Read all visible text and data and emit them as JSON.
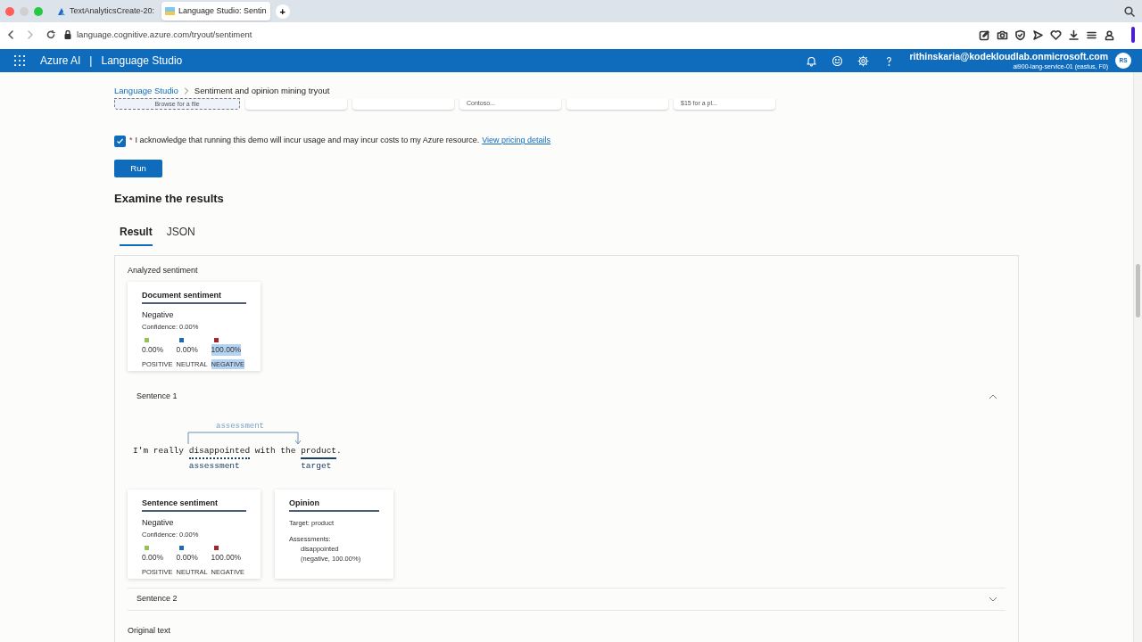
{
  "browser": {
    "tabs": [
      {
        "title": "TextAnalyticsCreate-20:",
        "selected": false
      },
      {
        "title": "Language Studio: Sentin",
        "selected": true
      }
    ],
    "new_tab": "+",
    "url": "language.cognitive.azure.com/tryout/sentiment"
  },
  "header": {
    "brand": "Azure AI",
    "separator": "|",
    "product": "Language Studio",
    "account": "rithinskaria@kodekloudlab.onmicrosoft.com",
    "resource": "ai900-lang-service-01 (eastus, F0)",
    "avatar": "RS"
  },
  "breadcrumb": [
    "Language Studio",
    "Sentiment and opinion mining tryout"
  ],
  "samples": [
    {
      "kind": "browse",
      "text": "Browse for a file"
    },
    {
      "kind": "card"
    },
    {
      "kind": "card"
    },
    {
      "kind": "card",
      "text": "Contoso..."
    },
    {
      "kind": "card"
    },
    {
      "kind": "card",
      "text": "$15 for a pl..."
    }
  ],
  "acknowledge": {
    "checked": true,
    "required": "*",
    "text": "I acknowledge that running this demo will incur usage and may incur costs to my Azure resource.",
    "link": "View pricing details"
  },
  "run_button": "Run",
  "results_heading": "Examine the results",
  "result_tabs": [
    {
      "label": "Result",
      "selected": true
    },
    {
      "label": "JSON",
      "selected": false
    }
  ],
  "analyzed_heading": "Analyzed sentiment",
  "document_sentiment": {
    "title": "Document sentiment",
    "label": "Negative",
    "confidence": "Confidence: 0.00%",
    "scores": [
      {
        "value": "0.00%",
        "name": "POSITIVE",
        "color": "#92c353",
        "selected": false
      },
      {
        "value": "0.00%",
        "name": "NEUTRAL",
        "color": "#1f6bb3",
        "selected": false
      },
      {
        "value": "100.00%",
        "name": "NEGATIVE",
        "color": "#a4262c",
        "selected": true
      }
    ]
  },
  "sentences": [
    {
      "title": "Sentence 1",
      "expanded": true,
      "relation": "assessment",
      "tokens": [
        {
          "text": "I'm really ",
          "kind": "plain"
        },
        {
          "text": "disappointed",
          "kind": "assessment",
          "label": "assessment"
        },
        {
          "text": " with the ",
          "kind": "plain"
        },
        {
          "text": "product",
          "kind": "target",
          "label": "target"
        },
        {
          "text": ".",
          "kind": "plain"
        }
      ],
      "sentence_sentiment": {
        "title": "Sentence sentiment",
        "label": "Negative",
        "confidence": "Confidence: 0.00%",
        "scores": [
          {
            "value": "0.00%",
            "name": "POSITIVE",
            "color": "#92c353",
            "selected": false
          },
          {
            "value": "0.00%",
            "name": "NEUTRAL",
            "color": "#1f6bb3",
            "selected": false
          },
          {
            "value": "100.00%",
            "name": "NEGATIVE",
            "color": "#a4262c",
            "selected": false
          }
        ]
      },
      "opinion": {
        "title": "Opinion",
        "target": "Target: product",
        "assessments_label": "Assessments:",
        "assessment": "disappointed",
        "assessment_detail": "(negative, 100.00%)"
      }
    },
    {
      "title": "Sentence 2",
      "expanded": false
    }
  ],
  "original_text_heading": "Original text"
}
